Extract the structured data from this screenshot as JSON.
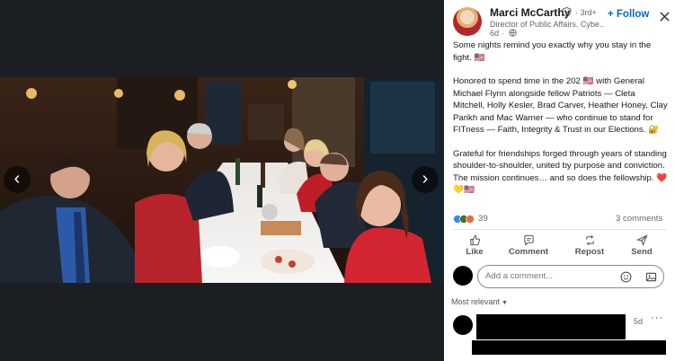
{
  "author": {
    "name": "Marci McCarthy",
    "degree": "· 3rd+",
    "headline": "Director of Public Affairs, Cybe...",
    "time": "6d ·",
    "follow_label": "+ Follow"
  },
  "post": {
    "paragraphs": [
      "Some nights remind you exactly why you stay in the fight. 🇺🇸",
      "Honored to spend time in the 202 🇺🇸 with General Michael Flynn alongside fellow Patriots — Cleta Mitchell, Holly Kesler, Brad Carver, Heather Honey, Clay Parikh and Mac Warner — who continue to stand for FITness — Faith, Integrity & Trust in our Elections. 🔐",
      "Grateful for friendships forged through years of standing shoulder-to-shoulder, united by purpose and conviction. The mission continues… and so does the fellowship. ❤️💛🇺🇸"
    ]
  },
  "stats": {
    "reactions": "39",
    "comments": "3 comments"
  },
  "actions": {
    "like": "Like",
    "comment": "Comment",
    "repost": "Repost",
    "send": "Send"
  },
  "comment_box": {
    "placeholder": "Add a comment..."
  },
  "sort": {
    "label": "Most relevant"
  },
  "comments": [
    {
      "time": "5d",
      "more": "···"
    }
  ],
  "icons": {
    "prev": "chevron-left-icon",
    "next": "chevron-right-icon",
    "close": "close-icon",
    "verified": "verified-shield-icon",
    "globe": "globe-icon"
  },
  "colors": {
    "accent": "#0a66c2",
    "dark_bg": "#1b1f23"
  }
}
